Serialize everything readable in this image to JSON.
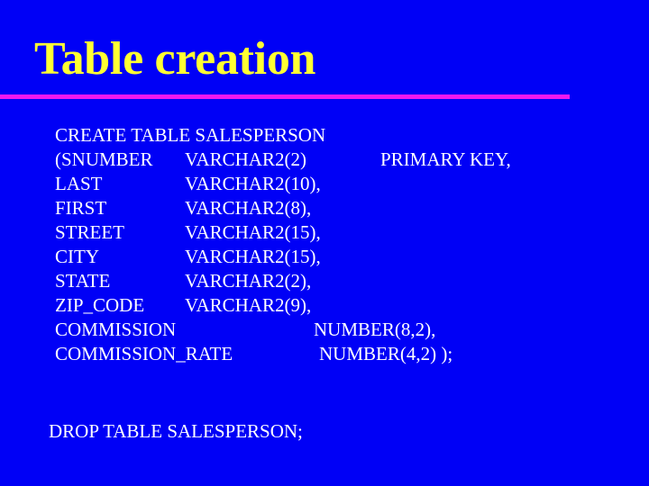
{
  "slide": {
    "title": "Table creation",
    "colors": {
      "background": "#0000f6",
      "title": "#ffff33",
      "rule": "#f018f0",
      "text": "#ffffff"
    },
    "create_statement": {
      "header": "CREATE TABLE SALESPERSON",
      "columns": [
        {
          "name": "(SNUMBER",
          "type": "VARCHAR2(2)",
          "constraint": "PRIMARY KEY,"
        },
        {
          "name": "LAST",
          "type": "VARCHAR2(10),"
        },
        {
          "name": "FIRST",
          "type": "VARCHAR2(8),"
        },
        {
          "name": "STREET",
          "type": "VARCHAR2(15),"
        },
        {
          "name": "CITY",
          "type": "VARCHAR2(15),"
        },
        {
          "name": "STATE",
          "type": "VARCHAR2(2),"
        },
        {
          "name": "ZIP_CODE",
          "type": "VARCHAR2(9),"
        },
        {
          "name": "COMMISSION",
          "type": "NUMBER(8,2),"
        },
        {
          "name": "COMMISSION_RATE",
          "type": "NUMBER(4,2) );"
        }
      ]
    },
    "drop_statement": "DROP TABLE SALESPERSON;"
  }
}
